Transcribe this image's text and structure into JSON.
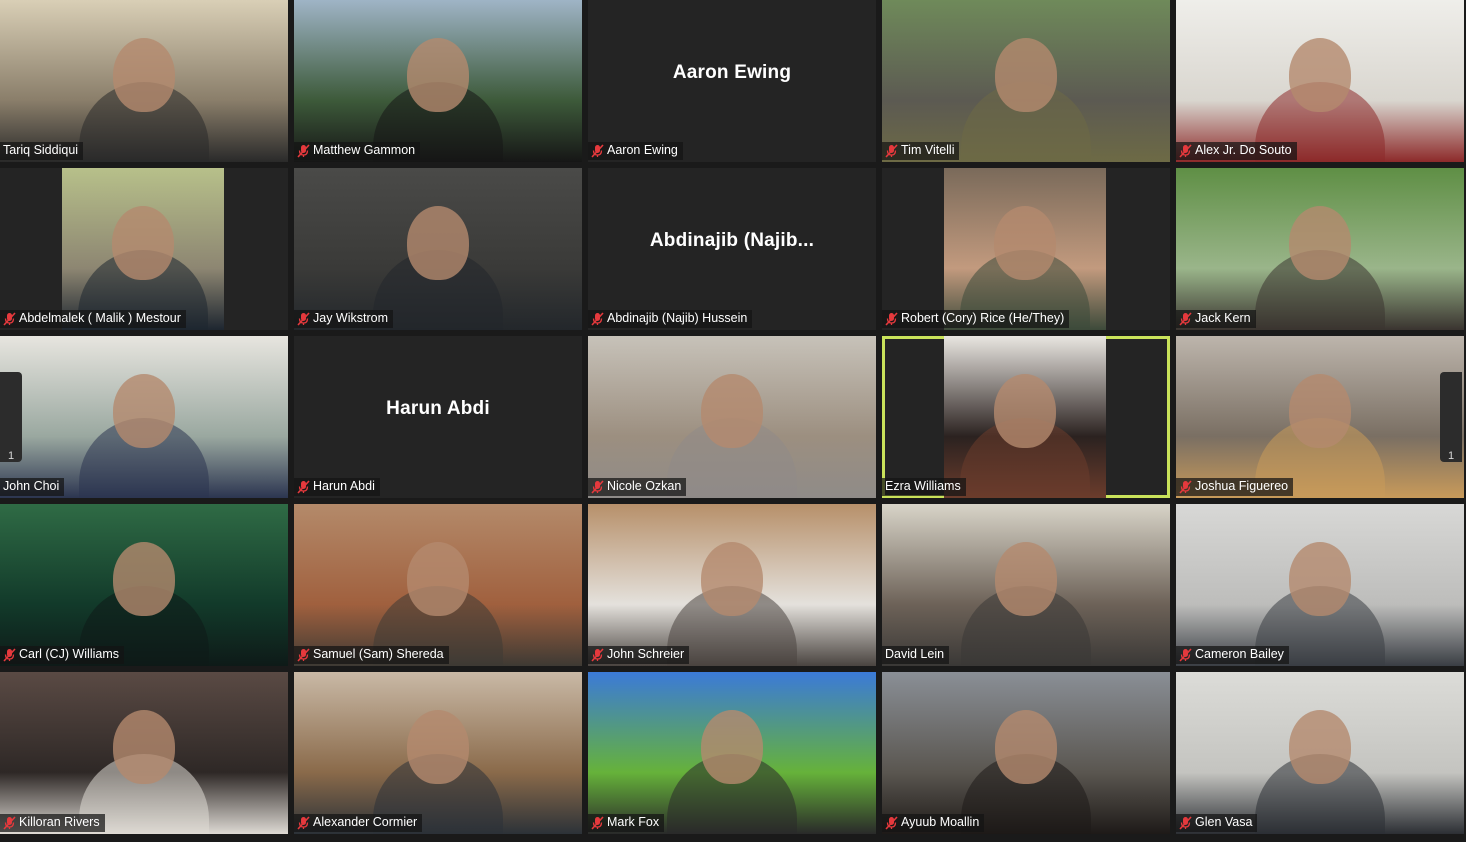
{
  "gallery": {
    "left_page_number": "1",
    "right_page_number": "1",
    "tiles": [
      {
        "name": "Tariq Siddiqui",
        "muted": false,
        "video": true,
        "active": false,
        "colors": [
          "#d9cfb6",
          "#8a7e6a",
          "#2a2a2a"
        ]
      },
      {
        "name": "Matthew Gammon",
        "muted": true,
        "video": true,
        "active": false,
        "colors": [
          "#9fb4c6",
          "#3d5a3a",
          "#161616"
        ]
      },
      {
        "name": "Aaron Ewing",
        "muted": true,
        "video": false,
        "active": false,
        "card_name": "Aaron Ewing"
      },
      {
        "name": "Tim Vitelli",
        "muted": true,
        "video": true,
        "active": false,
        "colors": [
          "#6f8a5a",
          "#5c5a52",
          "#6d6a45"
        ]
      },
      {
        "name": "Alex Jr. Do Souto",
        "muted": true,
        "video": true,
        "active": false,
        "colors": [
          "#efeeea",
          "#d9d6cf",
          "#8d2a2a"
        ]
      },
      {
        "name": "Abdelmalek ( Malik ) Mestour",
        "muted": true,
        "video": true,
        "active": false,
        "narrow": true,
        "colors": [
          "#b7c08a",
          "#8d8672",
          "#1e2630"
        ]
      },
      {
        "name": "Jay Wikstrom",
        "muted": true,
        "video": true,
        "active": false,
        "colors": [
          "#4a4a48",
          "#3a3a38",
          "#23272b"
        ]
      },
      {
        "name": "Abdinajib (Najib) Hussein",
        "muted": true,
        "video": false,
        "active": false,
        "card_name": "Abdinajib  (Najib..."
      },
      {
        "name": "Robert (Cory) Rice (He/They)",
        "muted": true,
        "video": true,
        "active": false,
        "narrow": true,
        "colors": [
          "#7a6a5a",
          "#c29a7e",
          "#3d4a3a"
        ]
      },
      {
        "name": "Jack Kern",
        "muted": true,
        "video": true,
        "active": false,
        "colors": [
          "#5f8f45",
          "#9ab58a",
          "#3a3430"
        ]
      },
      {
        "name": "John Choi",
        "muted": false,
        "video": true,
        "active": false,
        "colors": [
          "#e7e5df",
          "#9aa8a0",
          "#2c3550"
        ]
      },
      {
        "name": "Harun Abdi",
        "muted": true,
        "video": false,
        "active": false,
        "card_name": "Harun Abdi"
      },
      {
        "name": "Nicole Ozkan",
        "muted": true,
        "video": true,
        "active": false,
        "colors": [
          "#c7c2b9",
          "#9c8f80",
          "#8f8b88"
        ]
      },
      {
        "name": "Ezra Williams",
        "muted": false,
        "video": true,
        "active": true,
        "narrow": true,
        "colors": [
          "#e9e6e1",
          "#2b2220",
          "#6b3c2c"
        ]
      },
      {
        "name": "Joshua Figuereo",
        "muted": true,
        "video": true,
        "active": false,
        "colors": [
          "#bdb5ac",
          "#7a6f63",
          "#c89a5a"
        ]
      },
      {
        "name": "Carl (CJ) Williams",
        "muted": true,
        "video": true,
        "active": false,
        "colors": [
          "#2f6b45",
          "#123a2a",
          "#0e1a18"
        ]
      },
      {
        "name": "Samuel (Sam) Shereda",
        "muted": true,
        "video": true,
        "active": false,
        "colors": [
          "#b48a6a",
          "#a0603e",
          "#3e3a34"
        ]
      },
      {
        "name": "John Schreier",
        "muted": true,
        "video": true,
        "active": false,
        "colors": [
          "#b7906a",
          "#e4e1dc",
          "#4a4440"
        ]
      },
      {
        "name": "David Lein",
        "muted": false,
        "video": true,
        "active": false,
        "colors": [
          "#d8d4c8",
          "#6d6258",
          "#3a3836"
        ]
      },
      {
        "name": "Cameron Bailey",
        "muted": true,
        "video": true,
        "active": false,
        "colors": [
          "#d8d8d6",
          "#bdbdbb",
          "#3a3e44"
        ]
      },
      {
        "name": "Killoran Rivers",
        "muted": true,
        "video": true,
        "active": false,
        "colors": [
          "#5a4a44",
          "#2e2826",
          "#dedad4"
        ]
      },
      {
        "name": "Alexander Cormier",
        "muted": true,
        "video": true,
        "active": false,
        "colors": [
          "#c9b9a6",
          "#8a6a4a",
          "#2c3238"
        ]
      },
      {
        "name": "Mark Fox",
        "muted": true,
        "video": true,
        "active": false,
        "colors": [
          "#3b7ad8",
          "#66b23a",
          "#2a2a2a"
        ]
      },
      {
        "name": "Ayuub Moallin",
        "muted": true,
        "video": true,
        "active": false,
        "colors": [
          "#8a8f96",
          "#5a5650",
          "#1e1a18"
        ]
      },
      {
        "name": "Glen Vasa",
        "muted": true,
        "video": true,
        "active": false,
        "colors": [
          "#dcdcd8",
          "#c4c4c0",
          "#2c2f34"
        ]
      }
    ]
  },
  "colors": {
    "tile_bg": "#242424",
    "gallery_bg": "#1a1a1a",
    "active_speaker_border": "#c9e25a",
    "mute_icon": "#e5393d"
  },
  "icons": {
    "mute": "muted-microphone-icon"
  }
}
